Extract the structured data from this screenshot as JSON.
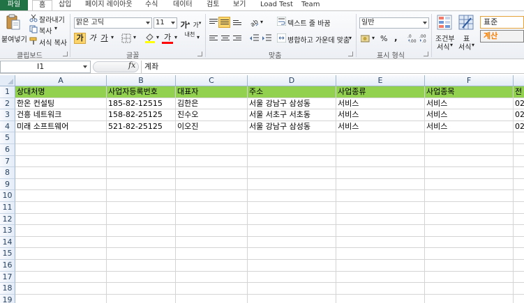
{
  "tabs": [
    {
      "label": "파일"
    },
    {
      "label": "홈"
    },
    {
      "label": "삽입"
    },
    {
      "label": "페이지 레이아웃"
    },
    {
      "label": "수식"
    },
    {
      "label": "데이터"
    },
    {
      "label": "검토"
    },
    {
      "label": "보기"
    },
    {
      "label": "Load Test"
    },
    {
      "label": "Team"
    }
  ],
  "ribbon": {
    "clipboard": {
      "paste": "붙여넣기",
      "cut": "잘라내기",
      "copy": "복사",
      "format_painter": "서식 복사",
      "group_label": "클립보드"
    },
    "font": {
      "name": "맑은 고딕",
      "size": "11",
      "group_label": "글꼴",
      "bold": "가",
      "italic": "가",
      "underline": "가",
      "grow": "가",
      "shrink": "가",
      "color_letter": "가",
      "phonetic": "내천"
    },
    "alignment": {
      "wrap_text": "텍스트 줄 바꿈",
      "merge_center": "병합하고 가운데 맞춤",
      "group_label": "맞춤"
    },
    "number": {
      "format": "일반",
      "percent": "%",
      "comma": ",",
      "group_label": "표시 형식"
    },
    "styles": {
      "conditional": "조건부",
      "conditional2": "서식",
      "table": "표",
      "table2": "서식",
      "normal": "표준",
      "calc": "계산"
    }
  },
  "formula_bar": {
    "name_box": "I1",
    "fx": "fx",
    "value": "계좌"
  },
  "columns": [
    "A",
    "B",
    "C",
    "D",
    "E",
    "F"
  ],
  "rows": [
    [
      "상대처명",
      "사업자등록번호",
      "대표자",
      "주소",
      "사업종류",
      "사업종목",
      "전"
    ],
    [
      "한온 컨설팅",
      "185-82-12515",
      "김한은",
      "서울 강남구 삼성동",
      "서비스",
      "서비스",
      "02-"
    ],
    [
      "건흥 네트워크",
      "158-82-25125",
      "진수오",
      "서울 서초구 서초동",
      "서비스",
      "서비스",
      "02-"
    ],
    [
      "미래 소프트웨어",
      "521-82-25125",
      "이오진",
      "서울 강남구 삼성동",
      "서비스",
      "서비스",
      "02-"
    ]
  ],
  "row_numbers": [
    "1",
    "2",
    "3",
    "4",
    "5",
    "6",
    "7",
    "8",
    "9",
    "10",
    "11",
    "12",
    "13",
    "14",
    "15",
    "16",
    "17",
    "18",
    "19"
  ],
  "colors": {
    "header_fill": "#92d050",
    "file_tab": "#217346",
    "calc_text": "#fa7d00"
  }
}
